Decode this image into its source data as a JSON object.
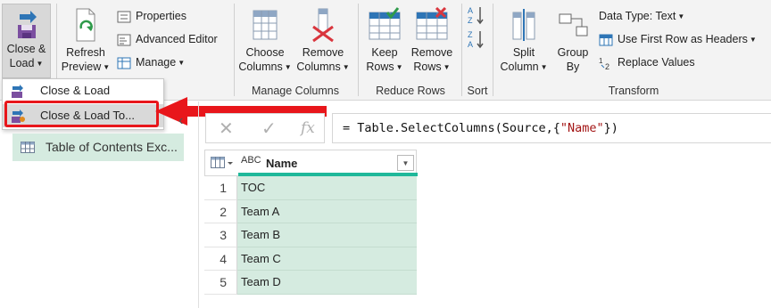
{
  "ribbon": {
    "close_load": {
      "line1": "Close &",
      "line2": "Load"
    },
    "refresh": {
      "line1": "Refresh",
      "line2": "Preview"
    },
    "properties": "Properties",
    "advanced_editor": "Advanced Editor",
    "manage": "Manage",
    "choose_columns": {
      "line1": "Choose",
      "line2": "Columns"
    },
    "remove_columns": {
      "line1": "Remove",
      "line2": "Columns"
    },
    "manage_columns_group": "Manage Columns",
    "keep_rows": {
      "line1": "Keep",
      "line2": "Rows"
    },
    "remove_rows": {
      "line1": "Remove",
      "line2": "Rows"
    },
    "reduce_rows_group": "Reduce Rows",
    "sort_group": "Sort",
    "split_column": {
      "line1": "Split",
      "line2": "Column"
    },
    "group_by": {
      "line1": "Group",
      "line2": "By"
    },
    "data_type": "Data Type: Text",
    "use_first_row": "Use First Row as Headers",
    "replace_values": "Replace Values",
    "transform_group": "Transform"
  },
  "dropdown": {
    "items": [
      "Close & Load",
      "Close & Load To..."
    ]
  },
  "queries": {
    "items": [
      "Table of Contents Exc..."
    ]
  },
  "formula": {
    "prefix": "= Table.SelectColumns(Source,{",
    "string": "\"Name\"",
    "suffix": "})",
    "fx": "fx"
  },
  "table": {
    "type_label": "ABC",
    "column": "Name",
    "rows": [
      {
        "n": "1",
        "v": "TOC"
      },
      {
        "n": "2",
        "v": "Team A"
      },
      {
        "n": "3",
        "v": "Team B"
      },
      {
        "n": "4",
        "v": "Team C"
      },
      {
        "n": "5",
        "v": "Team D"
      }
    ]
  },
  "colors": {
    "accent_red": "#e8161b",
    "query_green": "#d5ebe0",
    "quality_bar": "#1fb89a",
    "icon_blue": "#2e75b6"
  }
}
